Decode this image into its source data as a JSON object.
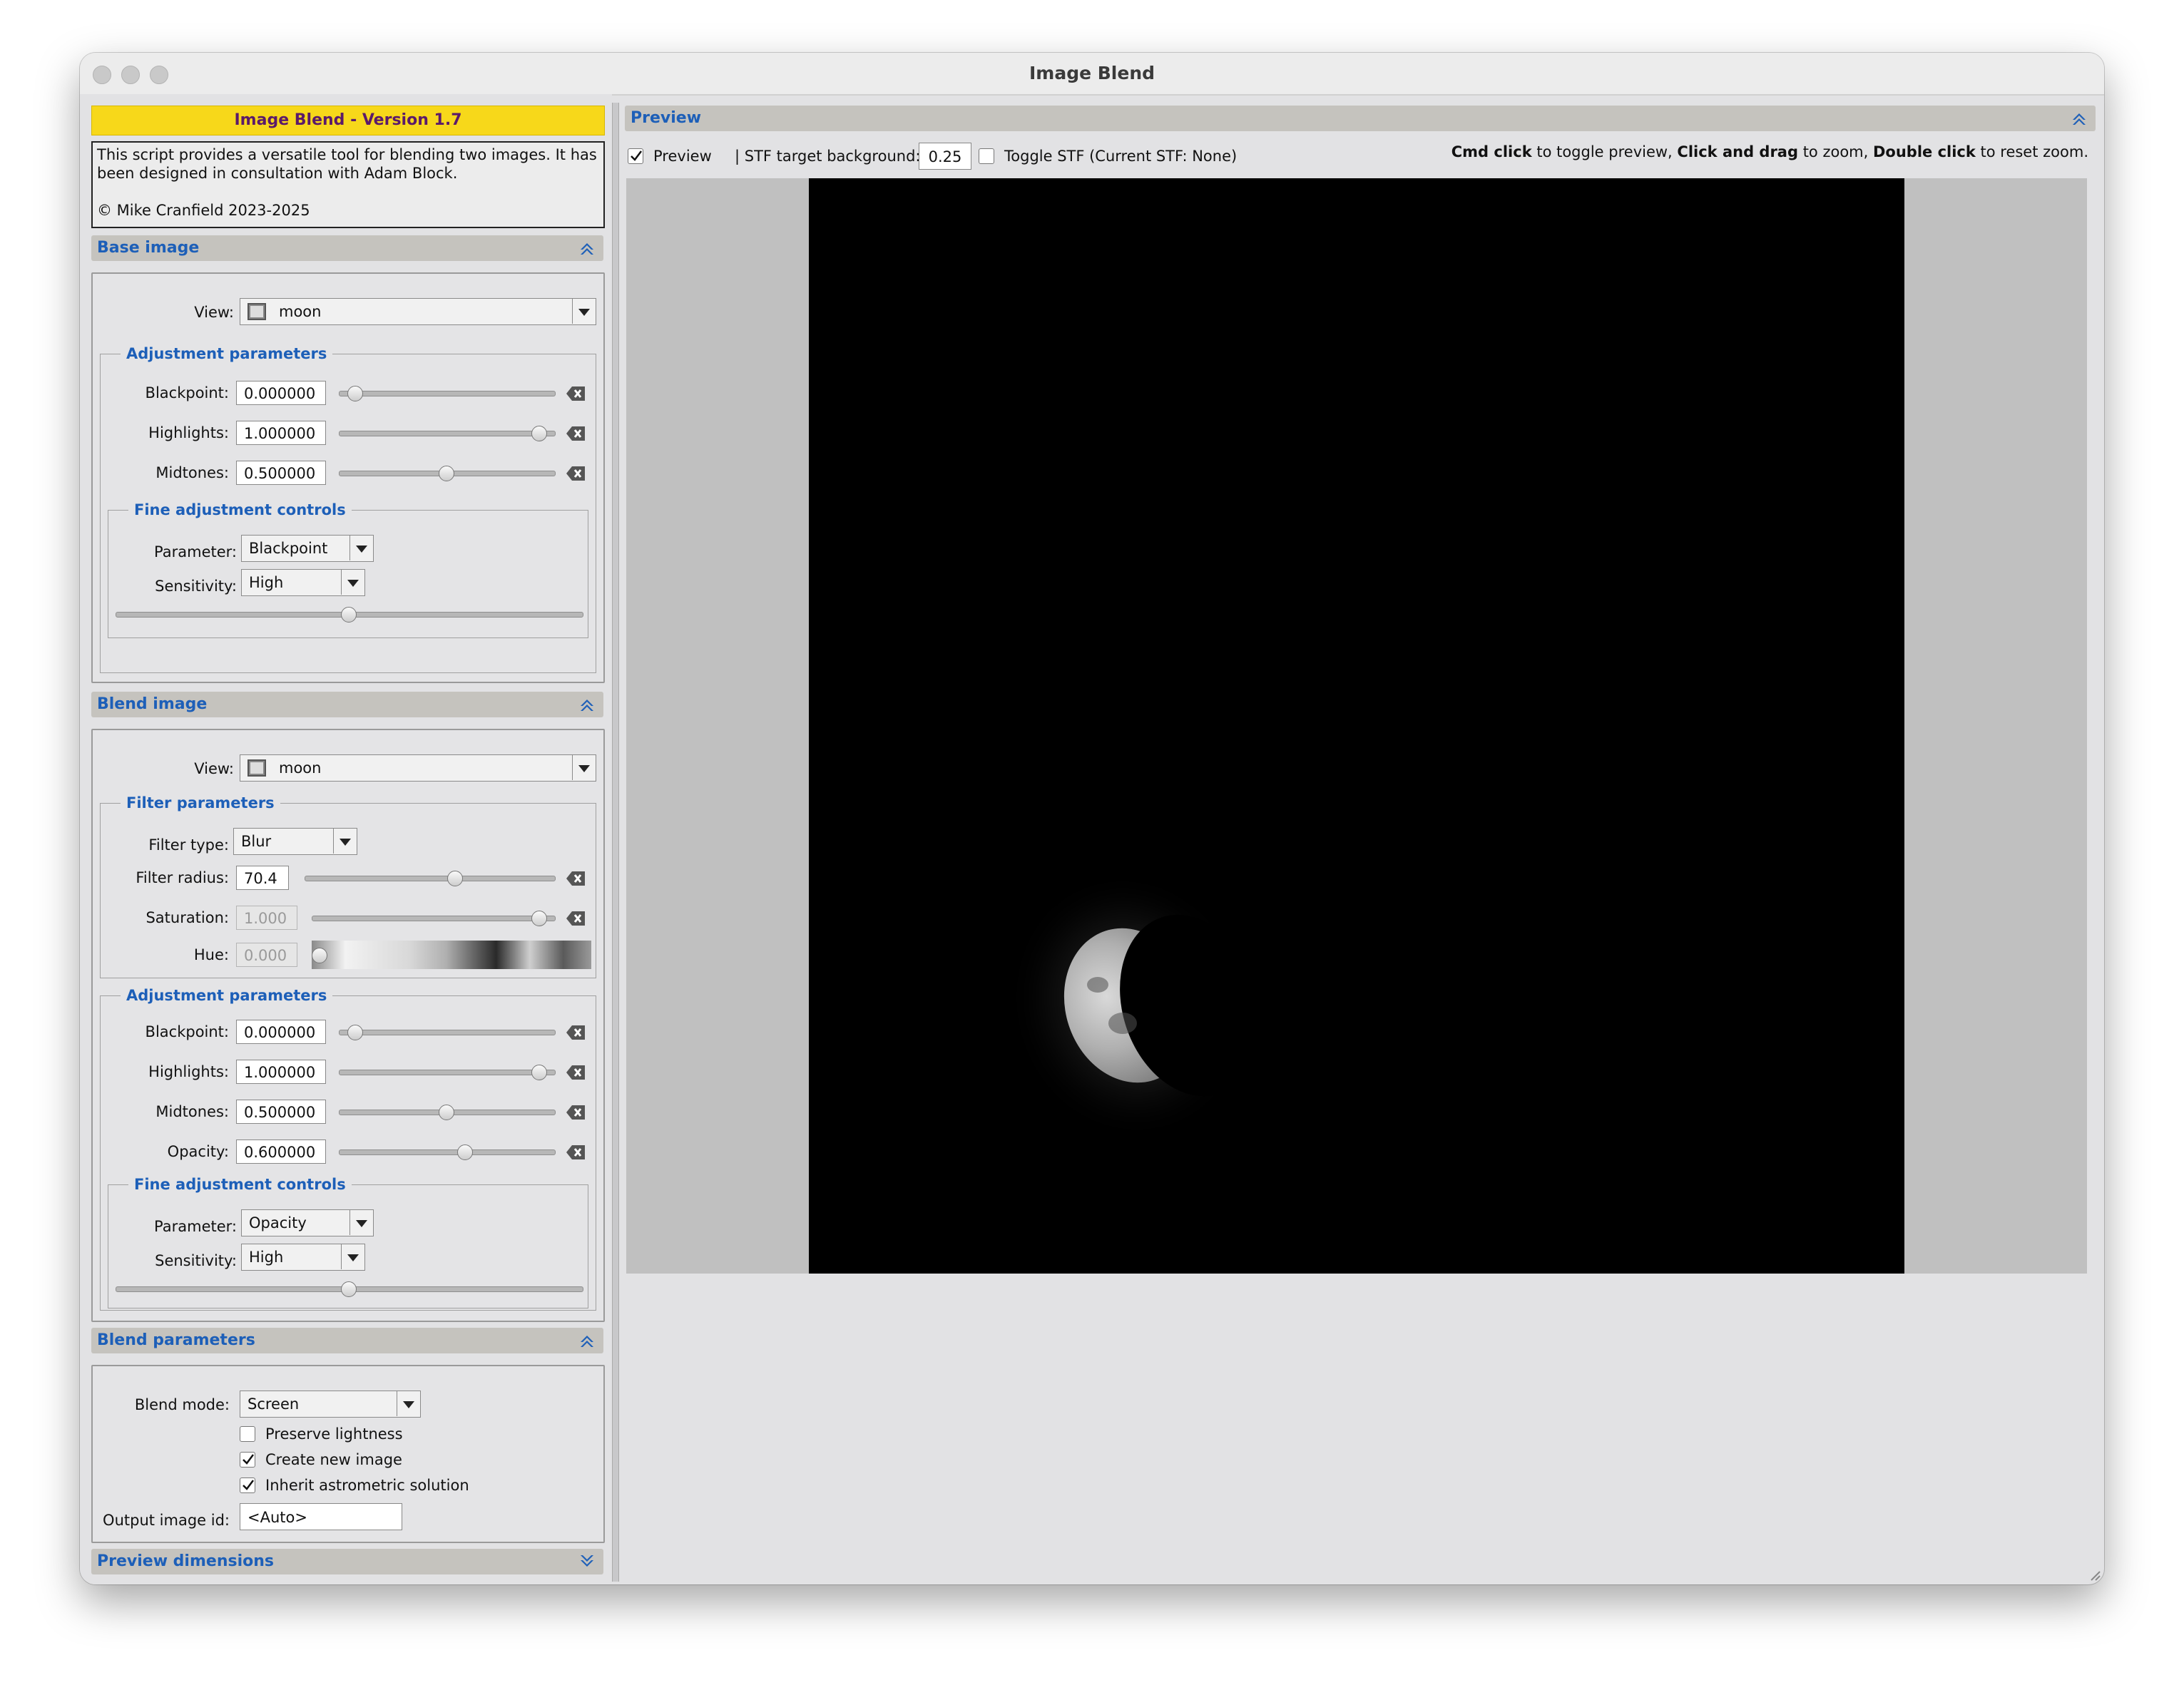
{
  "window": {
    "title": "Image Blend"
  },
  "banner": "Image Blend - Version 1.7",
  "info": {
    "line1": "This script provides a versatile tool for blending two images. It has",
    "line2": "been designed in consultation with Adam Block.",
    "copyright": "© Mike Cranfield 2023-2025"
  },
  "base_image": {
    "header": "Base image",
    "view_label": "View:",
    "view_value": "moon",
    "adjust_legend": "Adjustment parameters",
    "blackpoint_label": "Blackpoint:",
    "blackpoint": "0.000000",
    "blackpoint_level": 0.0,
    "highlights_label": "Highlights:",
    "highlights": "1.000000",
    "highlights_level": 1.0,
    "midtones_label": "Midtones:",
    "midtones": "0.500000",
    "midtones_level": 0.5,
    "fine_legend": "Fine adjustment controls",
    "parameter_label": "Parameter:",
    "parameter_value": "Blackpoint",
    "sensitivity_label": "Sensitivity:",
    "sensitivity_value": "High",
    "fine_level": 0.5
  },
  "blend_image": {
    "header": "Blend image",
    "view_label": "View:",
    "view_value": "moon",
    "filter_legend": "Filter parameters",
    "filter_type_label": "Filter type:",
    "filter_type_value": "Blur",
    "filter_radius_label": "Filter radius:",
    "filter_radius": "70.4",
    "saturation_label": "Saturation:",
    "saturation": "1.000",
    "hue_label": "Hue:",
    "hue": "0.000",
    "adjust_legend": "Adjustment parameters",
    "blackpoint_label": "Blackpoint:",
    "blackpoint": "0.000000",
    "highlights_label": "Highlights:",
    "highlights": "1.000000",
    "midtones_label": "Midtones:",
    "midtones": "0.500000",
    "opacity_label": "Opacity:",
    "opacity": "0.600000",
    "fine_legend": "Fine adjustment controls",
    "parameter_label": "Parameter:",
    "parameter_value": "Opacity",
    "sensitivity_label": "Sensitivity:",
    "sensitivity_value": "High"
  },
  "blend_params": {
    "header": "Blend parameters",
    "mode_label": "Blend mode:",
    "mode_value": "Screen",
    "preserve_lightness": "Preserve lightness",
    "create_new_image": "Create new image",
    "inherit_astrometric": "Inherit astrometric solution",
    "output_id_label": "Output image id:",
    "output_id_value": "<Auto>"
  },
  "preview_dimensions": {
    "header": "Preview dimensions"
  },
  "preview": {
    "header": "Preview",
    "checkbox_label": "Preview",
    "stf_label": "| STF target background:",
    "stf_value": "0.25",
    "toggle_stf": "Toggle STF (Current STF: None)",
    "hint_cmd": "Cmd click",
    "hint_cmd_tail": " to toggle preview, ",
    "hint_drag": "Click and drag",
    "hint_drag_tail": " to zoom, ",
    "hint_dbl": "Double click",
    "hint_dbl_tail": " to reset zoom."
  },
  "colors": {
    "accent": "#1d5fb8",
    "banner": "#f7d81a",
    "banner_text": "#5b1a6a"
  },
  "icons": [
    "reset-icon",
    "collapse-icon",
    "new-instance-icon",
    "execute-icon",
    "cancel-icon",
    "global-icon",
    "documentation-icon",
    "reset-all-icon"
  ]
}
